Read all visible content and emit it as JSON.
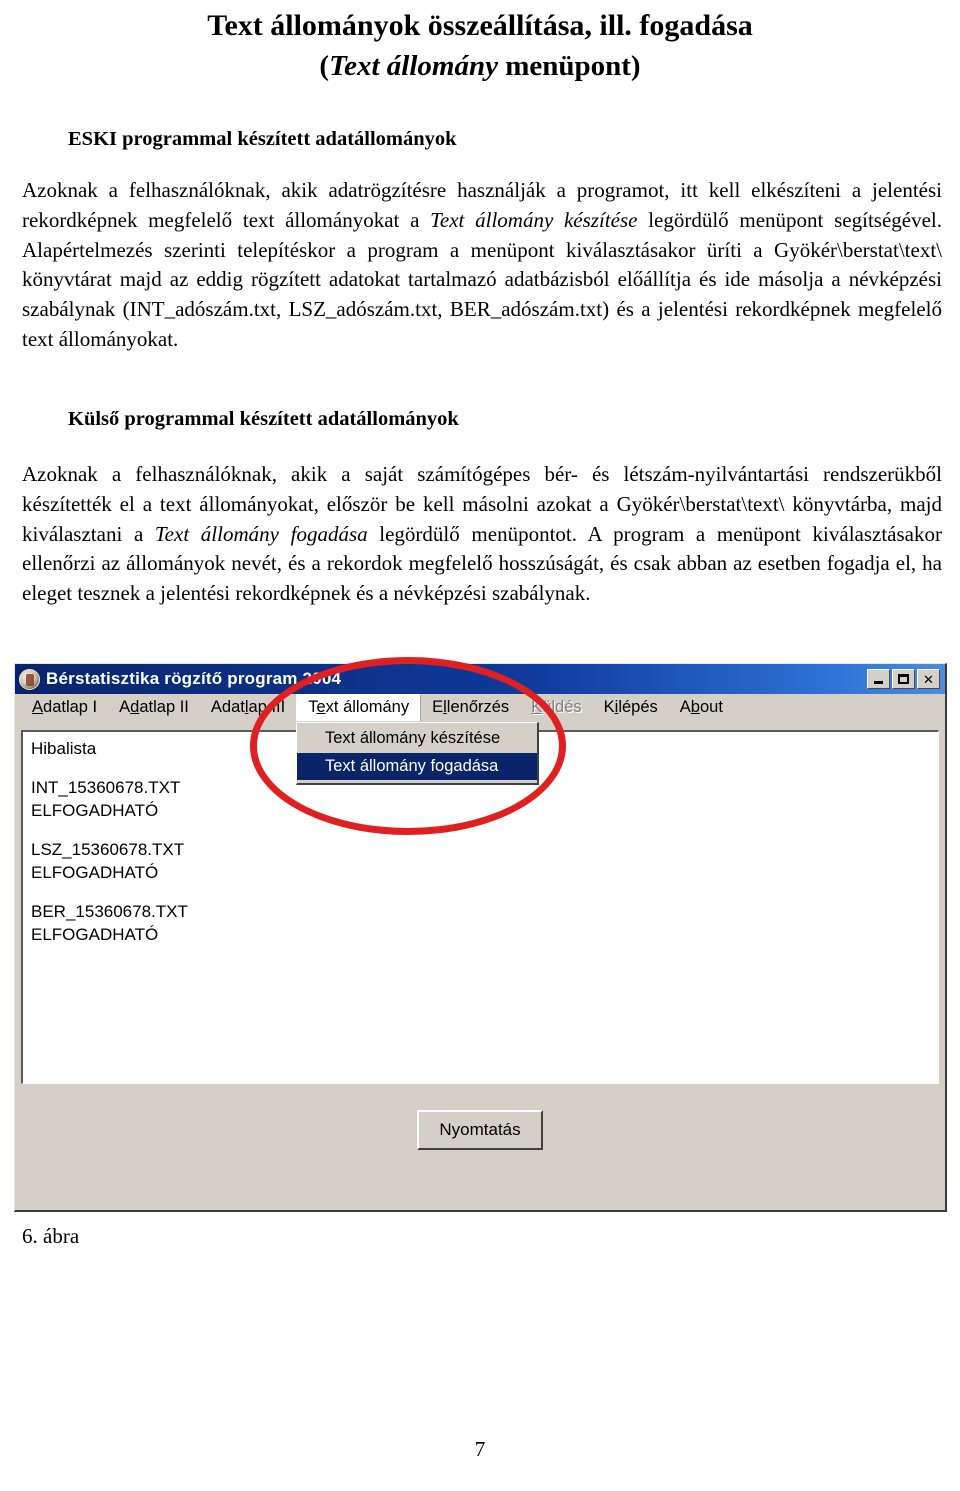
{
  "document": {
    "title_line1": "Text állományok összeállítása, ill. fogadása",
    "subtitle_italic": "Text állomány",
    "subtitle_rest": " menüpont)",
    "subtitle_open": "(",
    "section1": {
      "heading": "ESKI programmal készített adatállományok",
      "paragraph_part1": "Azoknak a felhasználóknak, akik adatrögzítésre használják a programot, itt kell elkészíteni a jelentési rekordképnek megfelelő text állományokat a ",
      "paragraph_italic1": "Text állomány készítése",
      "paragraph_part2": " legördülő menüpont segítségével. Alapértelmezés szerinti telepítéskor a program a menüpont kiválasztásakor üríti a Gyökér\\berstat\\text\\ könyvtárat majd az eddig rögzített adatokat tartalmazó adatbázisból előállítja és ide másolja a névképzési szabálynak (INT_adószám.txt, LSZ_adószám.txt, BER_adószám.txt) és a jelentési rekordképnek megfelelő text állományokat."
    },
    "section2": {
      "heading": "Külső programmal készített adatállományok",
      "paragraph_part1": "Azoknak a felhasználóknak, akik a saját számítógépes bér- és létszám-nyilvántartási rendszerükből készítették el a text állományokat, először be kell másolni azokat a Gyökér\\berstat\\text\\ könyvtárba, majd kiválasztani a ",
      "paragraph_italic1": "Text állomány fogadása",
      "paragraph_part2": " legördülő menüpontot. A program a menüpont kiválasztásakor ellenőrzi az állományok nevét, és a rekordok megfelelő hosszúságát, és csak abban az esetben fogadja el, ha eleget tesznek a jelentési rekordképnek és a névképzési szabálynak."
    },
    "figure_caption": "6. ábra",
    "page_number": "7"
  },
  "app": {
    "window_title": "Bérstatisztika rögzítő program 2004",
    "window_controls": {
      "minimize": "minimize-icon",
      "maximize": "maximize-icon",
      "close": "✕"
    },
    "menubar": [
      {
        "label": "Adatlap I",
        "accel": "A",
        "state": "normal"
      },
      {
        "label": "Adatlap II",
        "accel": "d",
        "state": "normal"
      },
      {
        "label": "Adatlap III",
        "accel": "l",
        "state": "normal"
      },
      {
        "label": "Text állomány",
        "accel": "e",
        "state": "open"
      },
      {
        "label": "Ellenőrzés",
        "accel": "l",
        "state": "normal"
      },
      {
        "label": "Küldés",
        "accel": "K",
        "state": "disabled"
      },
      {
        "label": "Kilépés",
        "accel": "i",
        "state": "normal"
      },
      {
        "label": "About",
        "accel": "b",
        "state": "normal"
      }
    ],
    "dropdown": {
      "parent": "Text állomány",
      "items": [
        {
          "label": "Text állomány készítése",
          "selected": false
        },
        {
          "label": "Text állomány fogadása",
          "selected": true
        }
      ],
      "highlight_color": "#0a246a"
    },
    "listbox": {
      "header": "Hibalista",
      "entries": [
        {
          "filename": "INT_15360678.TXT",
          "status": "ELFOGADHATÓ"
        },
        {
          "filename": "LSZ_15360678.TXT",
          "status": "ELFOGADHATÓ"
        },
        {
          "filename": "BER_15360678.TXT",
          "status": "ELFOGADHATÓ"
        }
      ]
    },
    "print_button": "Nyomtatás",
    "annotation": {
      "shape": "ellipse",
      "color": "#e02020"
    },
    "colors": {
      "titlebar_start": "#0a246a",
      "titlebar_end": "#4a8de0",
      "face": "#d4d0c8",
      "listbox_bg": "#ffffff"
    }
  }
}
